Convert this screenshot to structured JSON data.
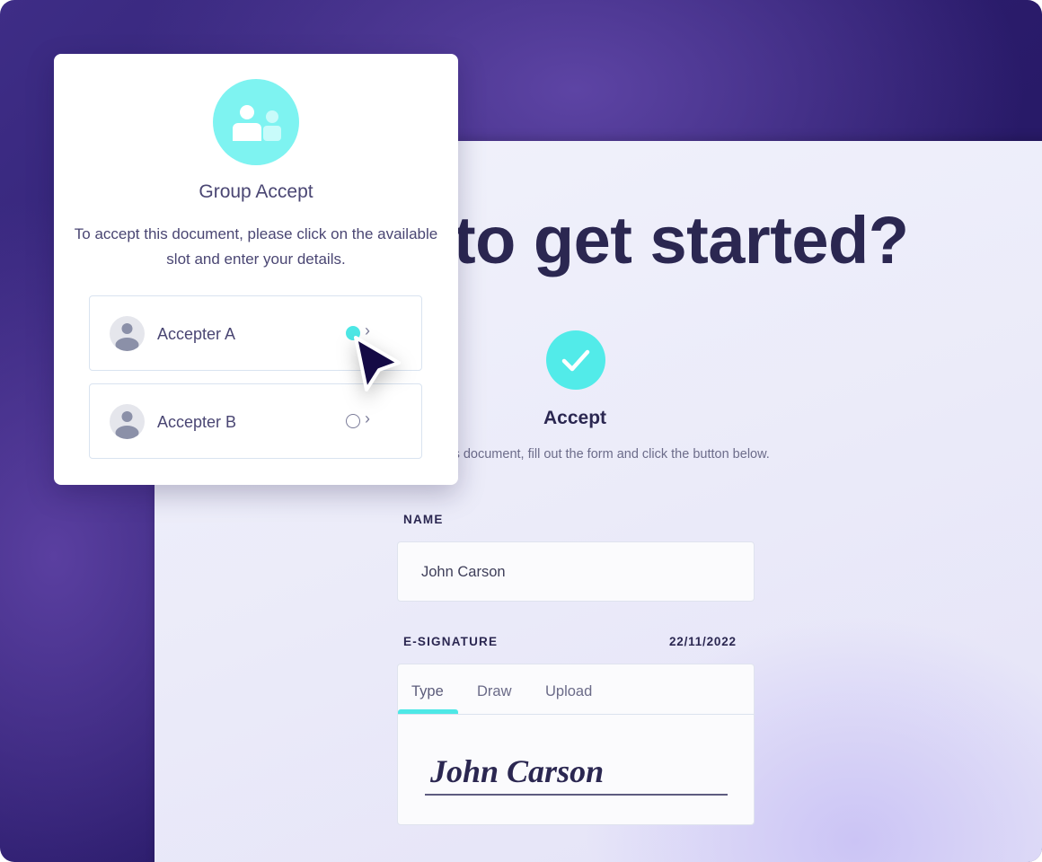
{
  "document": {
    "headline": "to get started?",
    "accept_title": "Accept",
    "accept_description": "To accept this document, fill out the form and click the button below.",
    "name_label": "NAME",
    "name_value": "John Carson",
    "signature_label": "E-SIGNATURE",
    "signature_date": "22/11/2022",
    "signature_tabs": [
      "Type",
      "Draw",
      "Upload"
    ],
    "active_tab": "Type",
    "signature_text": "John Carson"
  },
  "group_accept": {
    "icon": "group-users-icon",
    "title": "Group Accept",
    "description": "To accept this document, please click on the available slot and enter your details.",
    "slots": [
      {
        "label": "Accepter A",
        "selected": true
      },
      {
        "label": "Accepter B",
        "selected": false
      }
    ]
  },
  "colors": {
    "accent": "#4ee8e6",
    "text_dark": "#2b2751",
    "background": "#3e2d86"
  }
}
